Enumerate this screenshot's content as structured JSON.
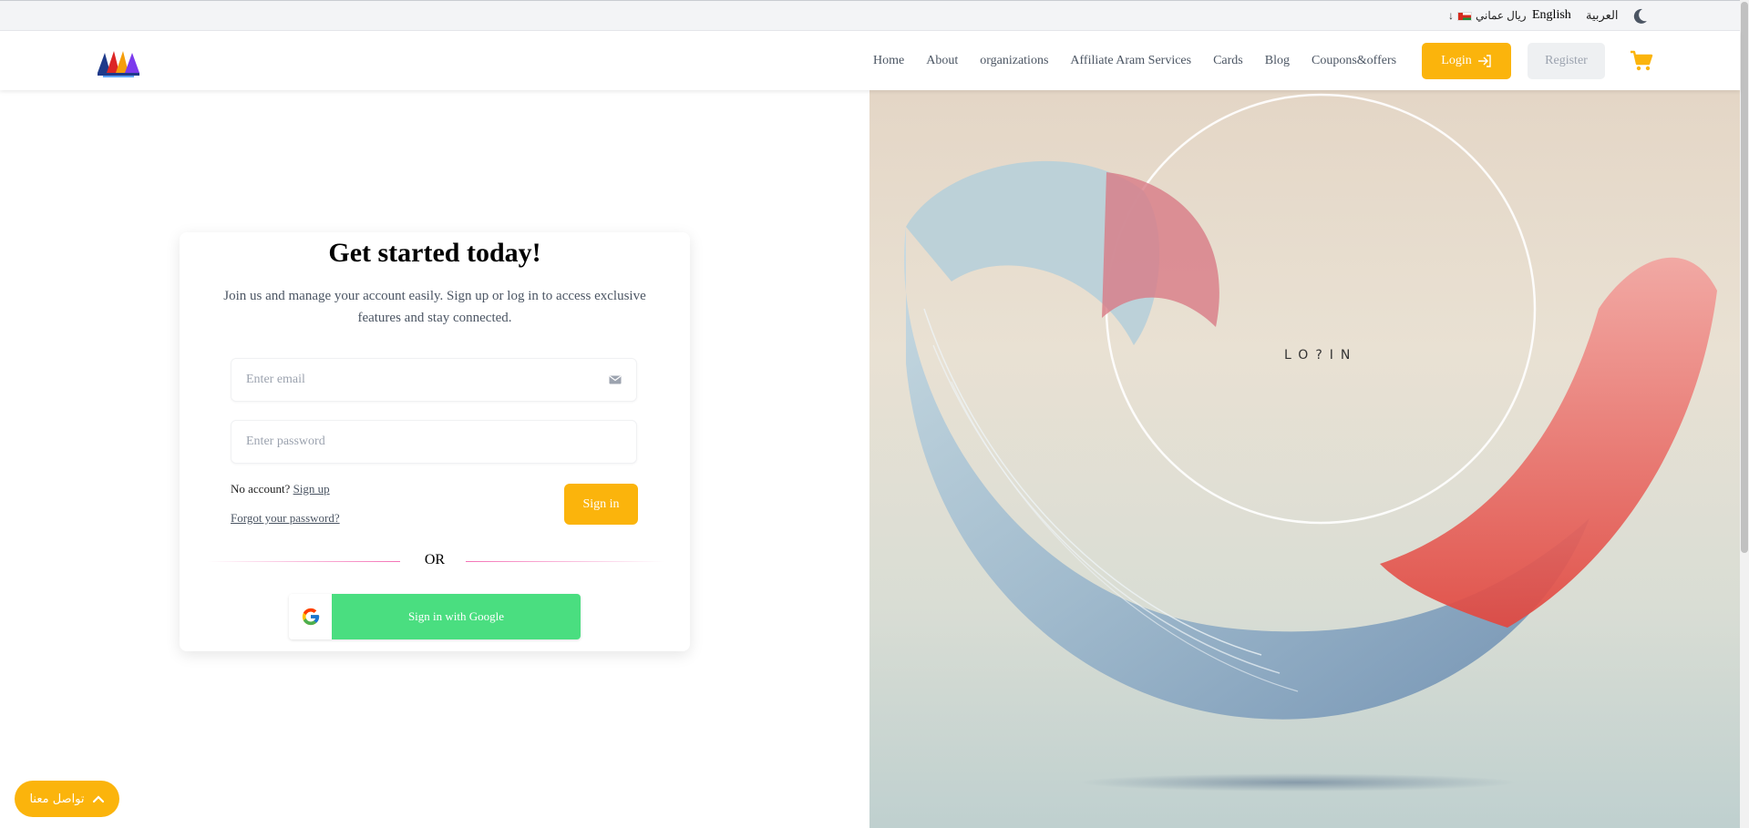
{
  "topbar": {
    "lang_ar": "العربية",
    "lang_en": "English",
    "currency": "ريال عماني",
    "icons": [
      "moon-icon",
      "oman-flag-icon",
      "arrow-down-icon"
    ]
  },
  "header": {
    "logo_alt": "ARAM",
    "nav": [
      {
        "label": "Home"
      },
      {
        "label": "About"
      },
      {
        "label": "organizations"
      },
      {
        "label": "Affiliate Aram Services"
      },
      {
        "label": "Cards"
      },
      {
        "label": "Blog"
      },
      {
        "label": "Coupons&offers"
      }
    ],
    "login_label": "Login",
    "register_label": "Register",
    "cart_icon": "cart-icon",
    "accent_color": "#fbb40c"
  },
  "card": {
    "title": "Get started today!",
    "subtitle": "Join us and manage your account easily. Sign up or log in to access exclusive features and stay connected.",
    "email_placeholder": "Enter email",
    "password_placeholder": "Enter password",
    "no_account": "No account?",
    "signup_link": "Sign up",
    "forgot_link": "Forgot your password?",
    "signin_label": "Sign in",
    "or_label": "OR",
    "google_label": "Sign in with Google",
    "google_color": "#4ade80"
  },
  "hero": {
    "text": "LO?IN"
  },
  "contact": {
    "label": "تواصل معنا"
  }
}
